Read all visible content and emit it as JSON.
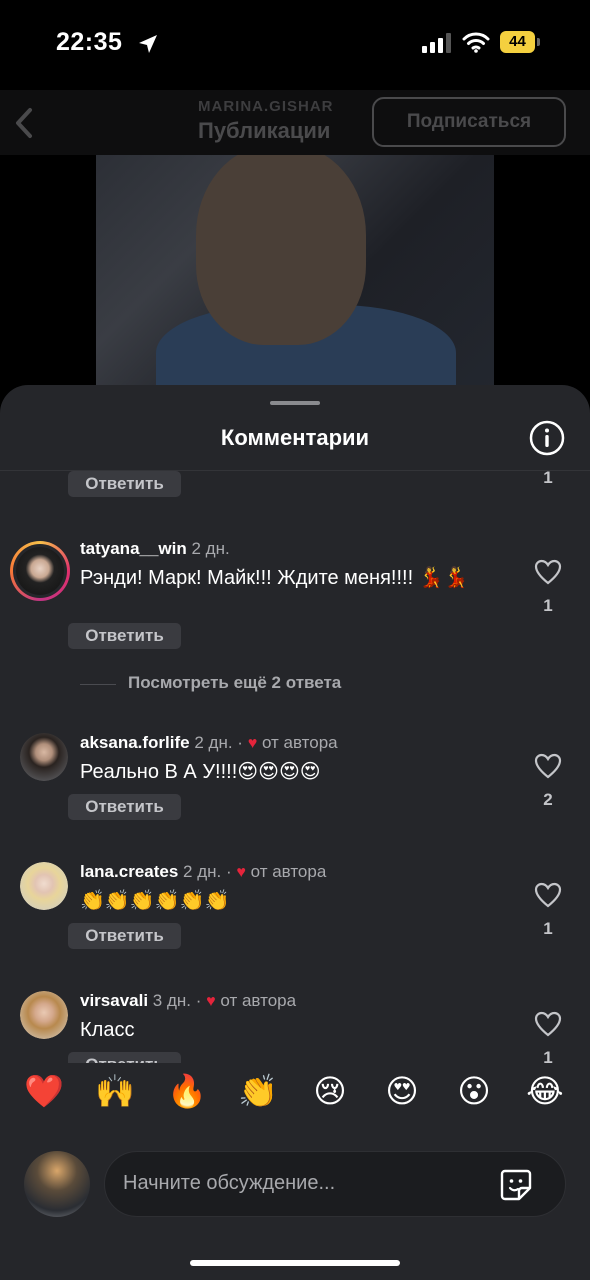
{
  "status_bar": {
    "time": "22:35",
    "battery": "44"
  },
  "header": {
    "username": "MARINA.GISHAR",
    "title": "Публикации",
    "subscribe_label": "Подписаться"
  },
  "sheet": {
    "title": "Комментарии"
  },
  "comments": [
    {
      "reply_label": "Ответить",
      "likes": "1"
    },
    {
      "username": "tatyana__win",
      "time": "2 дн.",
      "text": "Рэнди! Марк! Майк!!! Ждите меня!!!! 💃💃",
      "reply_label": "Ответить",
      "likes": "1",
      "view_more": "Посмотреть ещё 2 ответа"
    },
    {
      "username": "aksana.forlife",
      "time": "2 дн.",
      "separator": "·",
      "author_tag": "от автора",
      "text": "Реально В А У!!!!😍😍😍😍",
      "reply_label": "Ответить",
      "likes": "2"
    },
    {
      "username": "lana.creates",
      "time": "2 дн.",
      "separator": "·",
      "author_tag": "от автора",
      "text": "👏👏👏👏👏👏",
      "reply_label": "Ответить",
      "likes": "1"
    },
    {
      "username": "virsavali",
      "time": "3 дн.",
      "separator": "·",
      "author_tag": "от автора",
      "text": "Класс",
      "reply_label": "Ответить",
      "likes": "1"
    }
  ],
  "emoji_bar": [
    "❤️",
    "🙌",
    "🔥",
    "👏",
    "😢",
    "😍",
    "😮",
    "😂"
  ],
  "input": {
    "placeholder": "Начните обсуждение..."
  },
  "colors": {
    "sheet_bg": "#25262a",
    "author_heart": "#e5243b",
    "reply_bg": "#3a3b40"
  }
}
